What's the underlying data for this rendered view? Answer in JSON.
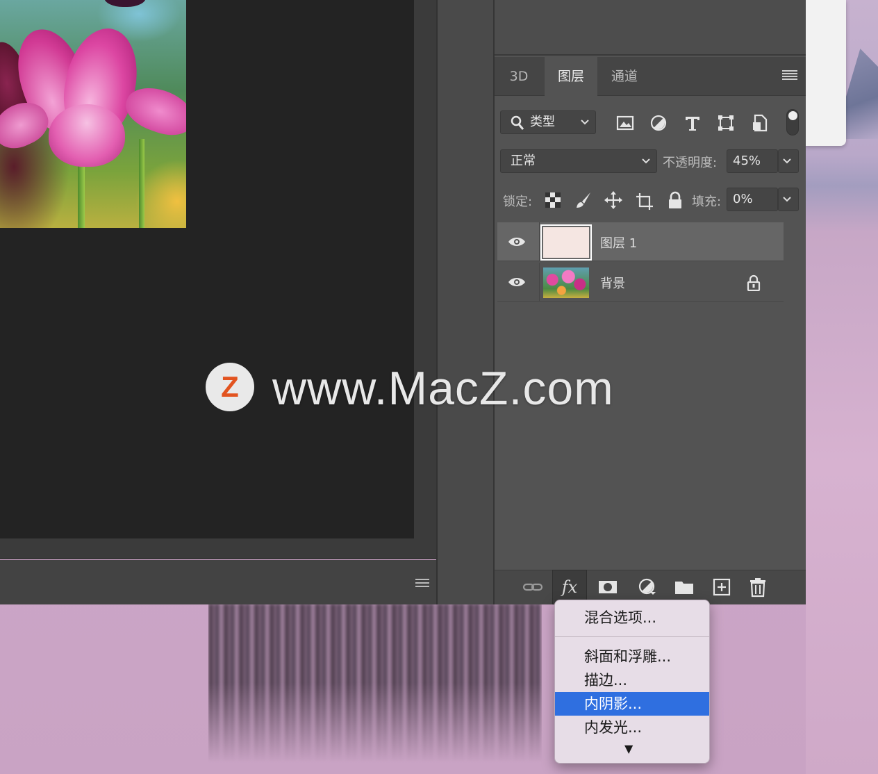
{
  "panel": {
    "tabs": [
      {
        "label": "3D"
      },
      {
        "label": "图层"
      },
      {
        "label": "通道"
      }
    ],
    "filter": {
      "label": "类型"
    },
    "blend_mode": "正常",
    "opacity": {
      "label": "不透明度:",
      "value": "45%"
    },
    "lock": {
      "label": "锁定:"
    },
    "fill": {
      "label": "填充:",
      "value": "0%"
    },
    "layers": [
      {
        "name": "图层 1",
        "selected": true
      },
      {
        "name": "背景",
        "locked": true
      }
    ]
  },
  "bottom_bar": {
    "fx_label": "fx"
  },
  "fx_menu": {
    "items": [
      {
        "label": "混合选项..."
      },
      {
        "label": "斜面和浮雕..."
      },
      {
        "label": "描边..."
      },
      {
        "label": "内阴影...",
        "highlighted": true
      },
      {
        "label": "内发光..."
      }
    ],
    "more_arrow": "▼"
  },
  "watermark": {
    "logo_letter": "Z",
    "text": "www.MacZ.com"
  },
  "colors": {
    "menu_highlight": "#2f6fe0",
    "panel_bg": "#535353",
    "canvas_bg": "#232323"
  }
}
